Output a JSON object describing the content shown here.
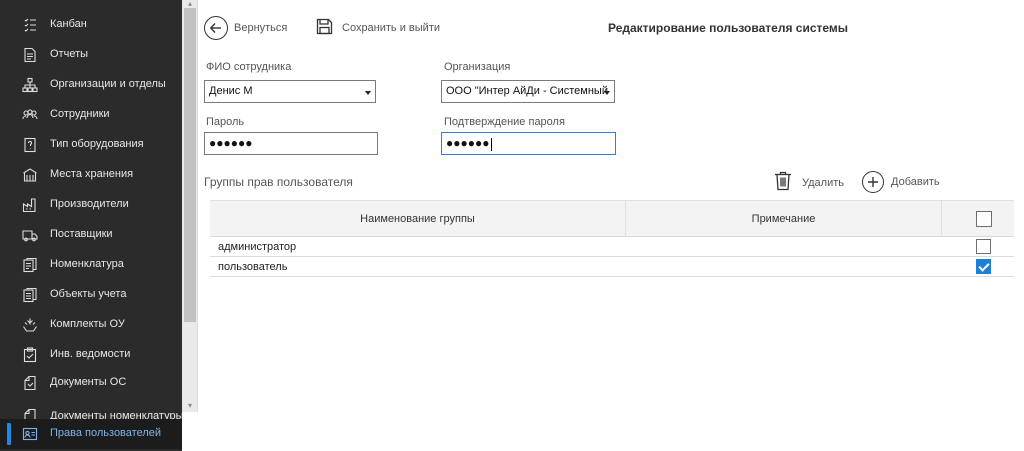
{
  "sidebar": {
    "items": [
      {
        "label": "Канбан",
        "icon": "kanban-icon"
      },
      {
        "label": "Отчеты",
        "icon": "report-icon"
      },
      {
        "label": "Организации и отделы",
        "icon": "org-structure-icon"
      },
      {
        "label": "Сотрудники",
        "icon": "employees-icon"
      },
      {
        "label": "Тип оборудования",
        "icon": "equipment-type-icon"
      },
      {
        "label": "Места хранения",
        "icon": "storage-icon"
      },
      {
        "label": "Производители",
        "icon": "factory-icon"
      },
      {
        "label": "Поставщики",
        "icon": "truck-icon"
      },
      {
        "label": "Номенклатура",
        "icon": "nomenclature-icon"
      },
      {
        "label": "Объекты учета",
        "icon": "accounting-objects-icon"
      },
      {
        "label": "Комплекты ОУ",
        "icon": "kits-icon"
      },
      {
        "label": "Инв. ведомости",
        "icon": "clipboard-check-icon"
      },
      {
        "label": "Документы ОС",
        "icon": "documents-icon"
      },
      {
        "label": "Документы номенклатуры",
        "icon": "nomenclature-docs-icon"
      },
      {
        "label": "Права пользователей",
        "icon": "user-rights-icon"
      }
    ],
    "active_index": 14,
    "accent": "#1e88e5"
  },
  "toolbar": {
    "back_label": "Вернуться",
    "save_label": "Сохранить и выйти",
    "title": "Редактирование пользователя системы"
  },
  "form": {
    "employee_label": "ФИО сотрудника",
    "employee_value": "Денис М",
    "org_label": "Организация",
    "org_value": "ООО \"Интер АйДи - Системный",
    "password_label": "Пароль",
    "password_value": "●●●●●●",
    "confirm_label": "Подтверждение пароля",
    "confirm_value": "●●●●●●"
  },
  "groups": {
    "title": "Группы прав пользователя",
    "delete_label": "Удалить",
    "add_label": "Добавить",
    "columns": [
      "Наименование группы",
      "Примечание"
    ],
    "rows": [
      {
        "name": "администратор",
        "note": "",
        "checked": false
      },
      {
        "name": "пользователь",
        "note": "",
        "checked": true
      }
    ]
  }
}
